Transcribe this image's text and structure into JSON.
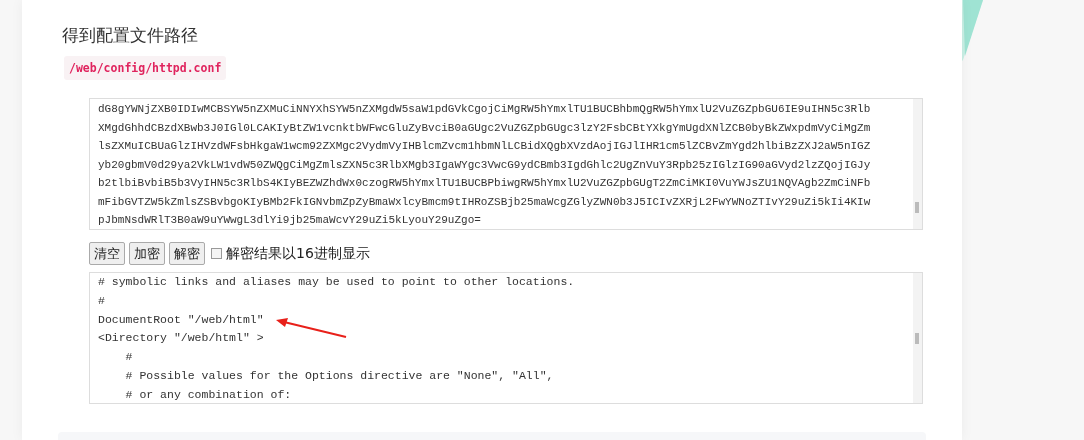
{
  "heading": "得到配置文件路径",
  "path_badge": "/web/config/httpd.conf",
  "encoded_text": [
    "dG8gYWNjZXB0IDIwMCBSYW5nZXMuCiNNYXhSYW5nZXMgdW5saW1pdGVkCgojCiMgRW5hYmxlTU1BUCBhbmQgRW5hYmxlU2VuZGZpbGU6IE9uIHN5c3Rlb",
    "XMgdGhhdCBzdXBwb3J0IGl0LCAKIyBtZW1vcnktbWFwcGluZyBvciB0aGUgc2VuZGZpbGUgc3lzY2FsbCBtYXkgYmUgdXNlZCB0byBkZWxpdmVyCiMgZm",
    "lsZXMuICBUaGlzIHVzdWFsbHkgaW1wcm92ZXMgc2VydmVyIHBlcmZvcm1hbmNlLCBidXQgbXVzdAojIGJlIHR1cm5lZCBvZmYgd2hlbiBzZXJ2aW5nIGZ",
    "yb20gbmV0d29ya2VkLW1vdW50ZWQgCiMgZmlsZXN5c3RlbXMgb3IgaWYgc3VwcG9ydCBmb3IgdGhlc2UgZnVuY3Rpb25zIGlzIG90aGVyd2lzZQojIGJy",
    "b2tlbiBvbiB5b3VyIHN5c3RlbS4KIyBEZWZhdWx0czogRW5hYmxlTU1BUCBPbiwgRW5hYmxlU2VuZGZpbGUgT2ZmCiMKI0VuYWJsZU1NQVAgb2ZmCiNFb",
    "mFibGVTZW5kZmlsZSBvbgoKIyBMb2FkIGNvbmZpZyBmaWxlcyBmcm9tIHRoZSBjb25maWcgZGlyZWN0b3J5ICIvZXRjL2FwYWNoZTIvY29uZi5kIi4KIw",
    "pJbmNsdWRlT3B0aW9uYWwgL3dlYi9jb25maWcvY29uZi5kLyouY29uZgo="
  ],
  "buttons": [
    "清空",
    "加密",
    "解密"
  ],
  "hex_option": {
    "label": "解密结果以16进制显示",
    "checked": false
  },
  "decoded_text": [
    "# symbolic links and aliases may be used to point to other locations.",
    "#",
    "DocumentRoot \"/web/html\"",
    "<Directory \"/web/html\" >",
    "    #",
    "    # Possible values for the Options directive are \"None\", \"All\",",
    "    # or any combination of:"
  ]
}
